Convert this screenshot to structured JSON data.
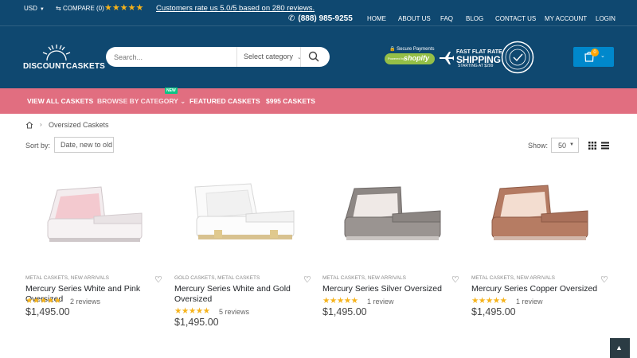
{
  "topbar": {
    "currency": "USD",
    "compare": "COMPARE (0)",
    "stars": "★★★★★",
    "rating_text": "Customers rate us 5.0/5 based on 280 reviews.",
    "phone": "(888) 985-9255",
    "nav": [
      "HOME",
      "ABOUT US",
      "FAQ",
      "BLOG",
      "CONTACT US",
      "MY ACCOUNT",
      "LOGIN"
    ]
  },
  "logo": {
    "text": "DISCOUNTCASKETS"
  },
  "search": {
    "placeholder": "Search...",
    "category": "Select category"
  },
  "badges": {
    "secure_title": "Secure Payments",
    "powered_by": "Powered by",
    "shopify": "shopify",
    "shipping_line1": "FAST FLAT RATE",
    "shipping_line2": "SHIPPING",
    "shipping_line3": "STARTING AT $299"
  },
  "cart": {
    "count": "0"
  },
  "main_nav": {
    "items": [
      "VIEW ALL CASKETS",
      "BROWSE BY CATEGORY",
      "FEATURED CASKETS",
      "$995 CASKETS"
    ],
    "new_badge": "NEW"
  },
  "breadcrumb": {
    "current": "Oversized Caskets"
  },
  "toolbar": {
    "sort_label": "Sort by:",
    "sort_value": "Date, new to old",
    "show_label": "Show:",
    "show_value": "50"
  },
  "products": [
    {
      "categories": "METAL CASKETS, NEW ARRIVALS",
      "name": "Mercury Series White and Pink Oversized",
      "stars": "★★★★★",
      "reviews": "2 reviews",
      "price": "$1,495.00"
    },
    {
      "categories": "GOLD CASKETS, METAL CASKETS",
      "name": "Mercury Series White and Gold Oversized",
      "stars": "★★★★★",
      "reviews": "5 reviews",
      "price": "$1,495.00"
    },
    {
      "categories": "METAL CASKETS, NEW ARRIVALS",
      "name": "Mercury Series Silver Oversized",
      "stars": "★★★★★",
      "reviews": "1 review",
      "price": "$1,495.00"
    },
    {
      "categories": "METAL CASKETS, NEW ARRIVALS",
      "name": "Mercury Series Copper Oversized",
      "stars": "★★★★★",
      "reviews": "1 review",
      "price": "$1,495.00"
    }
  ],
  "colors": {
    "header_bg": "#0f4870",
    "nav_pink": "#e16e80",
    "cart_blue": "#0088cc",
    "star_gold": "#f6b31b",
    "new_green": "#0cc485"
  }
}
